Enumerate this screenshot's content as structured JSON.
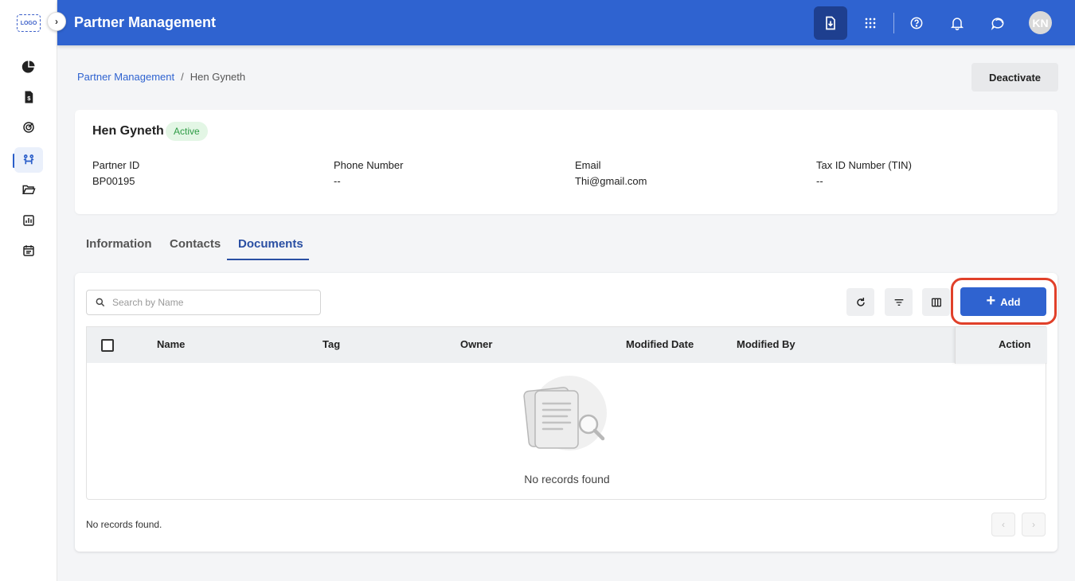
{
  "app": {
    "logo_text": "LOGO",
    "title": "Partner Management",
    "avatar_initials": "KN",
    "collapse_glyph": "›"
  },
  "sidebar": {
    "items": [
      {
        "icon": "pie-chart-icon",
        "active": false
      },
      {
        "icon": "invoice-icon",
        "active": false
      },
      {
        "icon": "target-icon",
        "active": false
      },
      {
        "icon": "partners-icon",
        "active": true
      },
      {
        "icon": "folder-open-icon",
        "active": false
      },
      {
        "icon": "report-chart-icon",
        "active": false
      },
      {
        "icon": "calendar-icon",
        "active": false
      }
    ]
  },
  "header_icons": [
    "download-icon",
    "apps-grid-icon",
    "help-icon",
    "bell-icon",
    "chat-icon"
  ],
  "breadcrumb": {
    "parent": "Partner Management",
    "separator": "/",
    "current": "Hen Gyneth"
  },
  "actions": {
    "deactivate_label": "Deactivate"
  },
  "partner": {
    "name": "Hen Gyneth",
    "status": "Active",
    "fields": [
      {
        "label": "Partner ID",
        "value": "BP00195"
      },
      {
        "label": "Phone Number",
        "value": "--"
      },
      {
        "label": "Email",
        "value": "Thi@gmail.com"
      },
      {
        "label": "Tax ID Number (TIN)",
        "value": "--"
      }
    ]
  },
  "tabs": [
    {
      "label": "Information",
      "active": false
    },
    {
      "label": "Contacts",
      "active": false
    },
    {
      "label": "Documents",
      "active": true
    }
  ],
  "documents": {
    "search_placeholder": "Search by Name",
    "search_value": "",
    "add_label": "Add",
    "add_glyph": "+",
    "columns": [
      "Name",
      "Tag",
      "Owner",
      "Modified Date",
      "Modified By",
      "Action"
    ],
    "rows": [],
    "empty_message": "No records found",
    "footer_message": "No records found.",
    "pagination": {
      "prev_glyph": "‹",
      "next_glyph": "›"
    }
  },
  "colors": {
    "brand": "#2f63d0",
    "highlight": "#e0402a",
    "status_active": "#2e9b45"
  }
}
